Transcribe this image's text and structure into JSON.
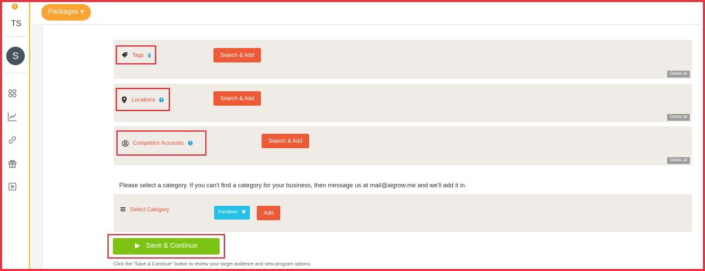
{
  "sidebar": {
    "badge": "5",
    "initials": "TS",
    "avatar_letter": "S",
    "icons": [
      "apps-grid-icon",
      "chart-icon",
      "link-icon",
      "gift-icon",
      "video-icon"
    ]
  },
  "topbar": {
    "packages_label": "Packages ▾"
  },
  "sections": {
    "tags": {
      "label": "Tags",
      "button": "Search & Add",
      "delete_all": "Delete all"
    },
    "locations": {
      "label": "Locations",
      "button": "Search & Add",
      "delete_all": "Delete all"
    },
    "competitors": {
      "label": "Competitor Accounts",
      "button": "Search & Add",
      "delete_all": "Delete all"
    }
  },
  "category": {
    "instruction": "Please select a category. If you can't find a category for your business, then message us at mail@aigrow.me and we'll add it in.",
    "select_label": "Select Category",
    "selected_chip": "Furniture",
    "chip_remove": "✖",
    "add_button": "Add"
  },
  "footer": {
    "save_button": "Save & Continue",
    "save_icon": "▶",
    "note": "Click the \"Save & Continue\" button to review your target audience and view program options."
  },
  "colors": {
    "accent_red": "#ee5a35",
    "highlight_border": "#e23c44",
    "save_green": "#7dc314",
    "chip_blue": "#24c0e8",
    "packages_orange": "#f8a332"
  }
}
